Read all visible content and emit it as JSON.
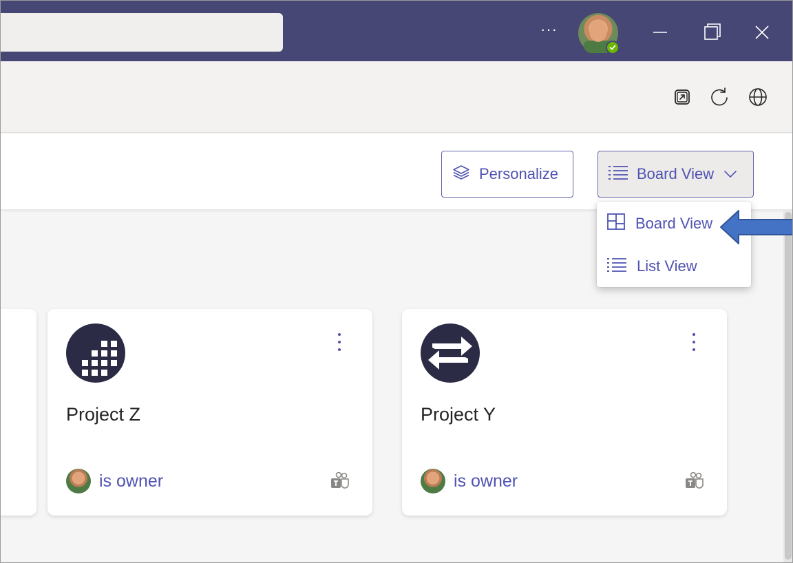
{
  "window": {
    "more_label": "···"
  },
  "header": {
    "personalize_label": "Personalize",
    "view_selected_label": "Board View"
  },
  "dropdown": {
    "items": [
      {
        "label": "Board View",
        "icon": "board-icon"
      },
      {
        "label": "List View",
        "icon": "list-icon"
      }
    ]
  },
  "cards": [
    {
      "title": "Project Z",
      "owner_text": "is owner",
      "logo": "grid-building-logo"
    },
    {
      "title": "Project Y",
      "owner_text": "is owner",
      "logo": "swap-arrows-logo"
    }
  ],
  "colors": {
    "titlebar": "#464775",
    "accent": "#4f52b2",
    "status_online": "#6bb700",
    "annotation_arrow": "#4472c4"
  }
}
